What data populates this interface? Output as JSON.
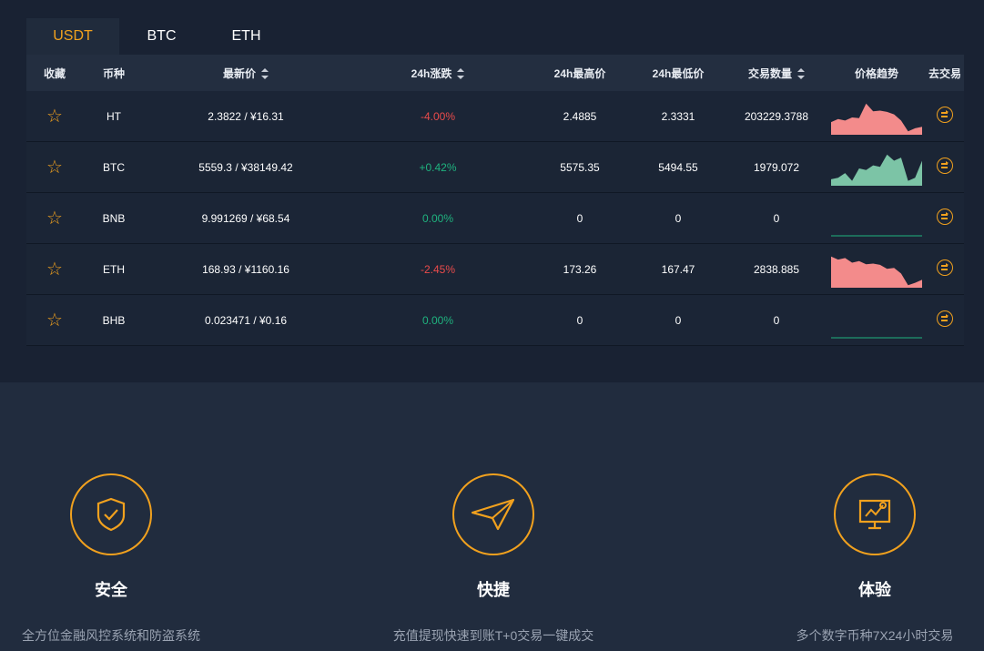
{
  "tabs": [
    "USDT",
    "BTC",
    "ETH"
  ],
  "columns": {
    "favorite": "收藏",
    "coin": "币种",
    "latest_price": "最新价",
    "change_24h": "24h涨跌",
    "high_24h": "24h最高价",
    "low_24h": "24h最低价",
    "volume": "交易数量",
    "trend": "价格趋势",
    "trade": "去交易"
  },
  "rows": [
    {
      "coin": "HT",
      "price": "2.3822 / ¥16.31",
      "change": "-4.00%",
      "dir": "down",
      "high": "2.4885",
      "low": "2.3331",
      "volume": "203229.3788",
      "trend": [
        0.35,
        0.45,
        0.4,
        0.5,
        0.48,
        0.95,
        0.7,
        0.72,
        0.68,
        0.6,
        0.4,
        0.05,
        0.15,
        0.2
      ]
    },
    {
      "coin": "BTC",
      "price": "5559.3 / ¥38149.42",
      "change": "+0.42%",
      "dir": "up",
      "high": "5575.35",
      "low": "5494.55",
      "volume": "1979.072",
      "trend": [
        0.15,
        0.2,
        0.35,
        0.1,
        0.5,
        0.45,
        0.6,
        0.55,
        0.95,
        0.75,
        0.85,
        0.1,
        0.2,
        0.75
      ]
    },
    {
      "coin": "BNB",
      "price": "9.991269 / ¥68.54",
      "change": "0.00%",
      "dir": "up",
      "high": "0",
      "low": "0",
      "volume": "0",
      "trend": [
        0,
        0,
        0,
        0,
        0,
        0,
        0,
        0,
        0,
        0,
        0,
        0,
        0,
        0
      ]
    },
    {
      "coin": "ETH",
      "price": "168.93 / ¥1160.16",
      "change": "-2.45%",
      "dir": "down",
      "high": "173.26",
      "low": "167.47",
      "volume": "2838.885",
      "trend": [
        0.95,
        0.85,
        0.9,
        0.75,
        0.8,
        0.7,
        0.72,
        0.68,
        0.55,
        0.58,
        0.4,
        0.02,
        0.1,
        0.2
      ]
    },
    {
      "coin": "BHB",
      "price": "0.023471 / ¥0.16",
      "change": "0.00%",
      "dir": "up",
      "high": "0",
      "low": "0",
      "volume": "0",
      "trend": [
        0,
        0,
        0,
        0,
        0,
        0,
        0,
        0,
        0,
        0,
        0,
        0,
        0,
        0
      ]
    }
  ],
  "icons": {
    "favorite": "star-outline-icon",
    "trade": "exchange-arrows-icon"
  },
  "colors": {
    "accent": "#f1a11e",
    "down": "#ea4b4b",
    "up": "#1fb37f",
    "down_fill": "#f38b8b",
    "up_fill": "#7cc4a6"
  },
  "features": [
    {
      "icon": "shield-check-icon",
      "title": "安全",
      "desc": "全方位金融风控系统和防盗系统"
    },
    {
      "icon": "paper-plane-icon",
      "title": "快捷",
      "desc": "充值提现快速到账T+0交易一键成交"
    },
    {
      "icon": "presentation-chart-icon",
      "title": "体验",
      "desc": "多个数字币种7X24小时交易"
    }
  ]
}
